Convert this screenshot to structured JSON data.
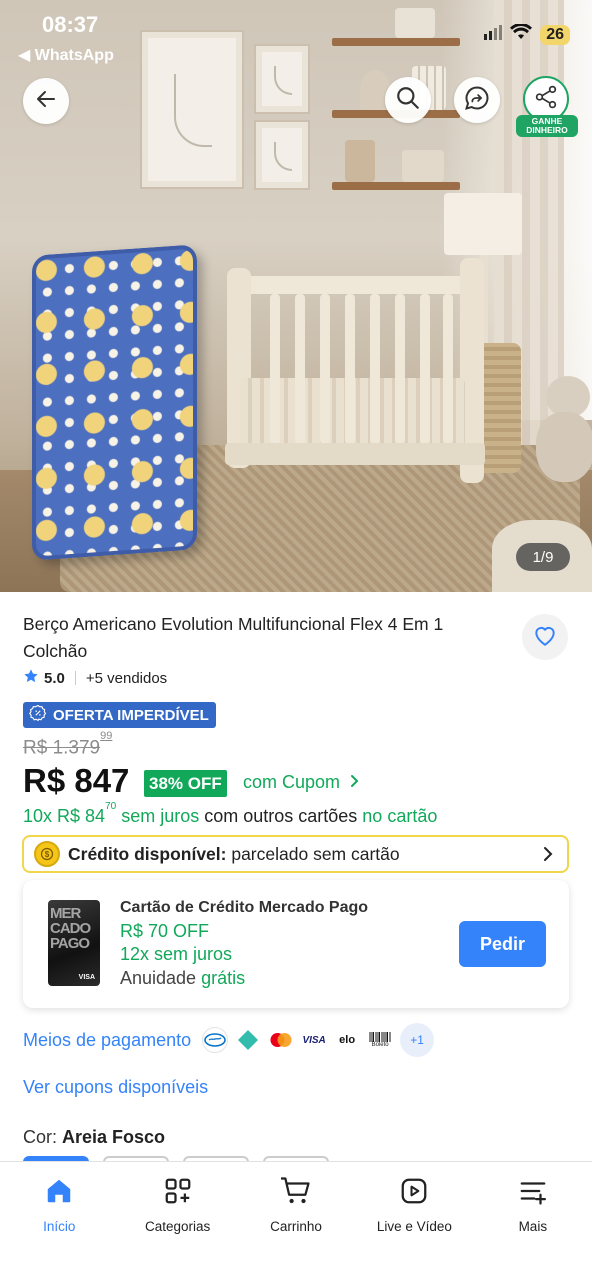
{
  "status_bar": {
    "time": "08:37",
    "back_app": "◀ WhatsApp",
    "battery": "26"
  },
  "hero": {
    "image_counter": "1/9",
    "share_badge": "GANHE\nDINHEIRO"
  },
  "product": {
    "title": "Berço Americano Evolution Multifuncional Flex 4 Em 1 Colchão",
    "rating": "5.0",
    "sold": "+5 vendidos",
    "offer_badge": "OFERTA IMPERDÍVEL",
    "old_price": "R$ 1.379",
    "old_price_cents": "99",
    "price": "R$ 847",
    "discount": "38% OFF",
    "coupon_text": "com Cupom",
    "installments_prefix": "10x R$ 84",
    "installments_cents": "70",
    "installments_nointerest": " sem juros",
    "installments_other": " com outros cartões ",
    "installments_suffix": "no cartão"
  },
  "credit": {
    "label": "Crédito disponível:",
    "text": " parcelado sem cartão"
  },
  "card_offer": {
    "card_text": "MER\nCADO\nPAGO",
    "card_brand": "VISA",
    "title": "Cartão de Crédito Mercado Pago",
    "discount": "R$ 70 OFF",
    "installments": "12x sem juros",
    "annual_prefix": "Anuidade ",
    "annual_value": "grátis",
    "button": "Pedir"
  },
  "payments": {
    "label": "Meios de pagamento",
    "methods": [
      "mercado-pago",
      "pix",
      "mastercard",
      "VISA",
      "elo",
      "Boleto"
    ],
    "more": "+1"
  },
  "coupons_link": "Ver cupons disponíveis",
  "color": {
    "label": "Cor: ",
    "value": "Areia Fosco"
  },
  "nav": [
    {
      "label": "Início",
      "icon": "home-icon",
      "active": true
    },
    {
      "label": "Categorias",
      "icon": "categories-icon"
    },
    {
      "label": "Carrinho",
      "icon": "cart-icon"
    },
    {
      "label": "Live e Vídeo",
      "icon": "play-icon"
    },
    {
      "label": "Mais",
      "icon": "menu-plus-icon"
    }
  ],
  "colors": {
    "accent_blue": "#3483fa",
    "offer_blue": "#3368c6",
    "green": "#12a85a",
    "credit_border": "#f1d54a"
  }
}
